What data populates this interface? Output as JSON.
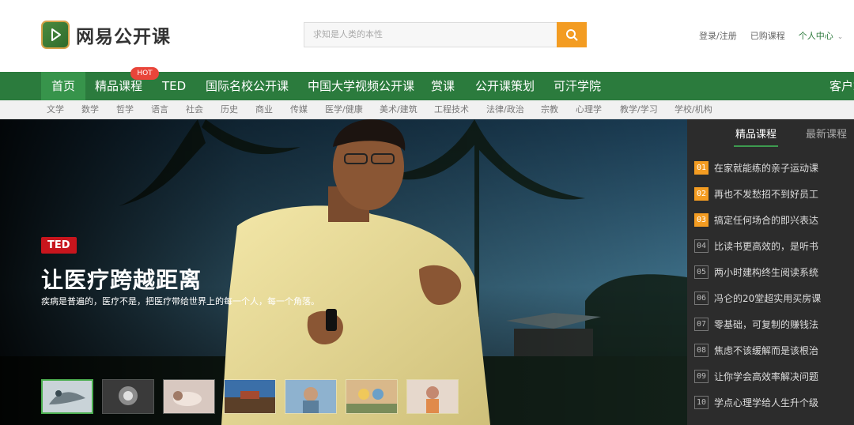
{
  "brand": {
    "name": "网易公开课"
  },
  "search": {
    "placeholder": "求知是人类的本性"
  },
  "top_links": {
    "login": "登录/注册",
    "purchased": "已购课程",
    "user_center": "个人中心",
    "plus": "+"
  },
  "nav": {
    "items": [
      {
        "label": "首页",
        "active": true
      },
      {
        "label": "精品课程"
      },
      {
        "label": "TED"
      },
      {
        "label": "国际名校公开课"
      },
      {
        "label": "中国大学视频公开课"
      },
      {
        "label": "赏课"
      },
      {
        "label": "公开课策划"
      },
      {
        "label": "可汗学院"
      },
      {
        "label": "客户端"
      }
    ],
    "hot_badge": "HOT"
  },
  "subnav": {
    "items": [
      "文学",
      "数学",
      "哲学",
      "语言",
      "社会",
      "历史",
      "商业",
      "传媒",
      "医学/健康",
      "美术/建筑",
      "工程技术",
      "法律/政治",
      "宗教",
      "心理学",
      "教学/学习",
      "学校/机构"
    ]
  },
  "hero": {
    "tag": "TED",
    "title": "让医疗跨越距离",
    "subtitle": "疾病是普遍的，医疗不是，把医疗带给世界上的每一个人，每一个角落。",
    "thumbnails": 7,
    "active_thumb": 0
  },
  "panel": {
    "tabs": [
      {
        "label": "精品课程",
        "active": true
      },
      {
        "label": "最新课程"
      }
    ],
    "items": [
      {
        "num": "01",
        "text": "在家就能练的亲子运动课"
      },
      {
        "num": "02",
        "text": "再也不发愁招不到好员工"
      },
      {
        "num": "03",
        "text": "搞定任何场合的即兴表达"
      },
      {
        "num": "04",
        "text": "比读书更高效的，是听书"
      },
      {
        "num": "05",
        "text": "两小时建构终生阅读系统"
      },
      {
        "num": "06",
        "text": "冯仑的20堂超实用买房课"
      },
      {
        "num": "07",
        "text": "零基础，可复制的赚钱法"
      },
      {
        "num": "08",
        "text": "焦虑不该缓解而是该根治"
      },
      {
        "num": "09",
        "text": "让你学会高效率解决问题"
      },
      {
        "num": "10",
        "text": "学点心理学给人生升个级"
      }
    ]
  },
  "colors": {
    "brand_green": "#2b7b3d",
    "accent_orange": "#f39c22",
    "hot_red": "#e9453a",
    "ted_red": "#c8151d"
  }
}
